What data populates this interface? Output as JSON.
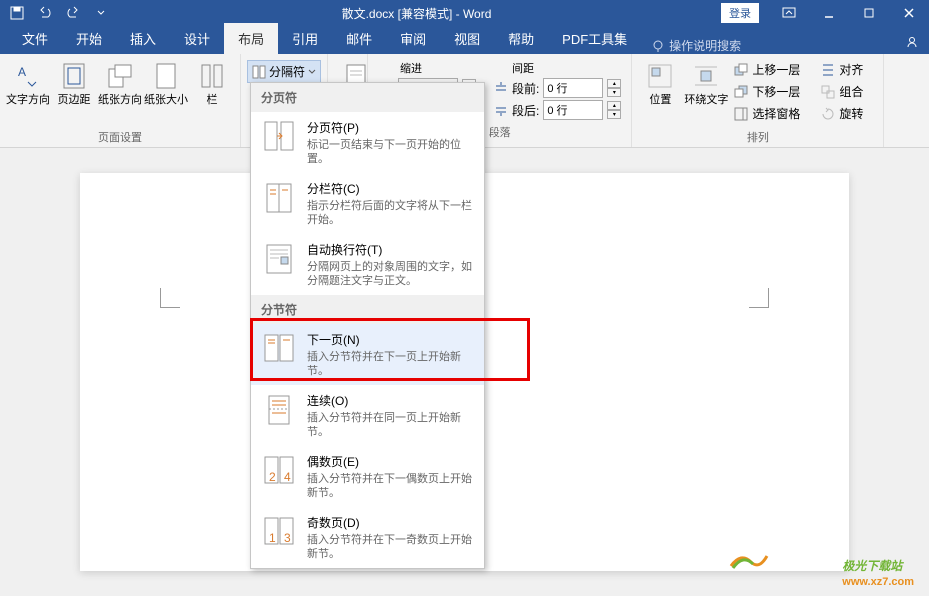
{
  "title": "散文.docx [兼容模式] - Word",
  "login": "登录",
  "tabs": [
    "文件",
    "开始",
    "插入",
    "设计",
    "布局",
    "引用",
    "邮件",
    "审阅",
    "视图",
    "帮助",
    "PDF工具集"
  ],
  "active_tab": "布局",
  "tell_me": "操作说明搜索",
  "ribbon": {
    "page_setup": {
      "label": "页面设置",
      "text_dir": "文字方向",
      "margins": "页边距",
      "orientation": "纸张方向",
      "size": "纸张大小",
      "columns": "栏"
    },
    "breaks_label": "分隔符",
    "paragraph": {
      "label": "段落",
      "indent_h": "缩进",
      "spacing_h": "间距",
      "before": "段前:",
      "after": "段后:",
      "before_v": "0 行",
      "after_v": "0 行"
    },
    "arrange": {
      "label": "排列",
      "position": "位置",
      "wrap": "环绕文字",
      "forward": "上移一层",
      "backward": "下移一层",
      "selection": "选择窗格",
      "align": "对齐",
      "group": "组合",
      "rotate": "旋转"
    }
  },
  "dropdown": {
    "sec1": "分页符",
    "items1": [
      {
        "t": "分页符(P)",
        "d": "标记一页结束与下一页开始的位置。"
      },
      {
        "t": "分栏符(C)",
        "d": "指示分栏符后面的文字将从下一栏开始。"
      },
      {
        "t": "自动换行符(T)",
        "d": "分隔网页上的对象周围的文字，如分隔题注文字与正文。"
      }
    ],
    "sec2": "分节符",
    "items2": [
      {
        "t": "下一页(N)",
        "d": "插入分节符并在下一页上开始新节。"
      },
      {
        "t": "连续(O)",
        "d": "插入分节符并在同一页上开始新节。"
      },
      {
        "t": "偶数页(E)",
        "d": "插入分节符并在下一偶数页上开始新节。"
      },
      {
        "t": "奇数页(D)",
        "d": "插入分节符并在下一奇数页上开始新节。"
      }
    ]
  },
  "watermark": {
    "main": "极光下载站",
    "sub": "www.xz7.com"
  }
}
